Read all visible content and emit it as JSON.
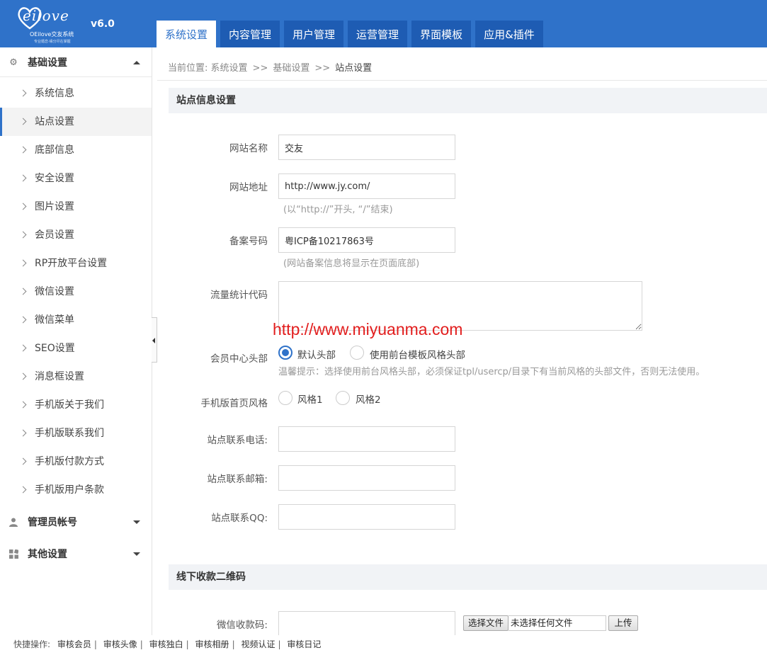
{
  "brand": {
    "logo_script": "eilove",
    "logo_sub": "OEilove交友系统",
    "logo_tagline": "专业婚恋·缘分尽在掌握",
    "version": "v6.0"
  },
  "tabs": [
    {
      "label": "系统设置"
    },
    {
      "label": "内容管理"
    },
    {
      "label": "用户管理"
    },
    {
      "label": "运营管理"
    },
    {
      "label": "界面模板"
    },
    {
      "label": "应用&插件"
    }
  ],
  "sidebar": {
    "group1": {
      "title": "基础设置",
      "icon": "gear-icon"
    },
    "items": [
      {
        "label": "系统信息"
      },
      {
        "label": "站点设置"
      },
      {
        "label": "底部信息"
      },
      {
        "label": "安全设置"
      },
      {
        "label": "图片设置"
      },
      {
        "label": "会员设置"
      },
      {
        "label": "RP开放平台设置"
      },
      {
        "label": "微信设置"
      },
      {
        "label": "微信菜单"
      },
      {
        "label": "SEO设置"
      },
      {
        "label": "消息框设置"
      },
      {
        "label": "手机版关于我们"
      },
      {
        "label": "手机版联系我们"
      },
      {
        "label": "手机版付款方式"
      },
      {
        "label": "手机版用户条款"
      }
    ],
    "group2": {
      "title": "管理员帐号",
      "icon": "user-icon"
    },
    "group3": {
      "title": "其他设置",
      "icon": "grid-icon"
    }
  },
  "breadcrumb": {
    "prefix": "当前位置:",
    "level1": "系统设置",
    "level2": "基础设置",
    "current": "站点设置",
    "sep": ">>"
  },
  "section1": {
    "title": "站点信息设置"
  },
  "form": {
    "site_name": {
      "label": "网站名称",
      "value": "交友"
    },
    "site_url": {
      "label": "网站地址",
      "value": "http://www.jy.com/",
      "hint": "(以“http://”开头, “/”结束)"
    },
    "icp": {
      "label": "备案号码",
      "value": "粤ICP备10217863号",
      "hint": "(网站备案信息将显示在页面底部)"
    },
    "stats_code": {
      "label": "流量统计代码",
      "value": ""
    },
    "member_header": {
      "label": "会员中心头部",
      "options": [
        "默认头部",
        "使用前台模板风格头部"
      ],
      "selected": "默认头部",
      "hint": "温馨提示：选择使用前台风格头部，必须保证tpl/usercp/目录下有当前风格的头部文件，否则无法使用。"
    },
    "mobile_style": {
      "label": "手机版首页风格",
      "options": [
        "风格1",
        "风格2"
      ]
    },
    "phone": {
      "label": "站点联系电话:",
      "value": ""
    },
    "email": {
      "label": "站点联系邮箱:",
      "value": ""
    },
    "qq": {
      "label": "站点联系QQ:",
      "value": ""
    }
  },
  "watermark": "http://www.miyuanma.com",
  "section2": {
    "title": "线下收款二维码"
  },
  "qrcode": {
    "label": "微信收款码:",
    "value": "",
    "choose_file": "选择文件",
    "no_file": "未选择任何文件",
    "upload": "上传"
  },
  "footer": {
    "label": "快捷操作:",
    "links": [
      "审核会员",
      "审核头像",
      "审核独白",
      "审核相册",
      "视频认证",
      "审核日记"
    ]
  },
  "colors": {
    "primary": "#2f72c9",
    "tab_bg": "#1e5cb3",
    "watermark": "#e21e1e"
  }
}
